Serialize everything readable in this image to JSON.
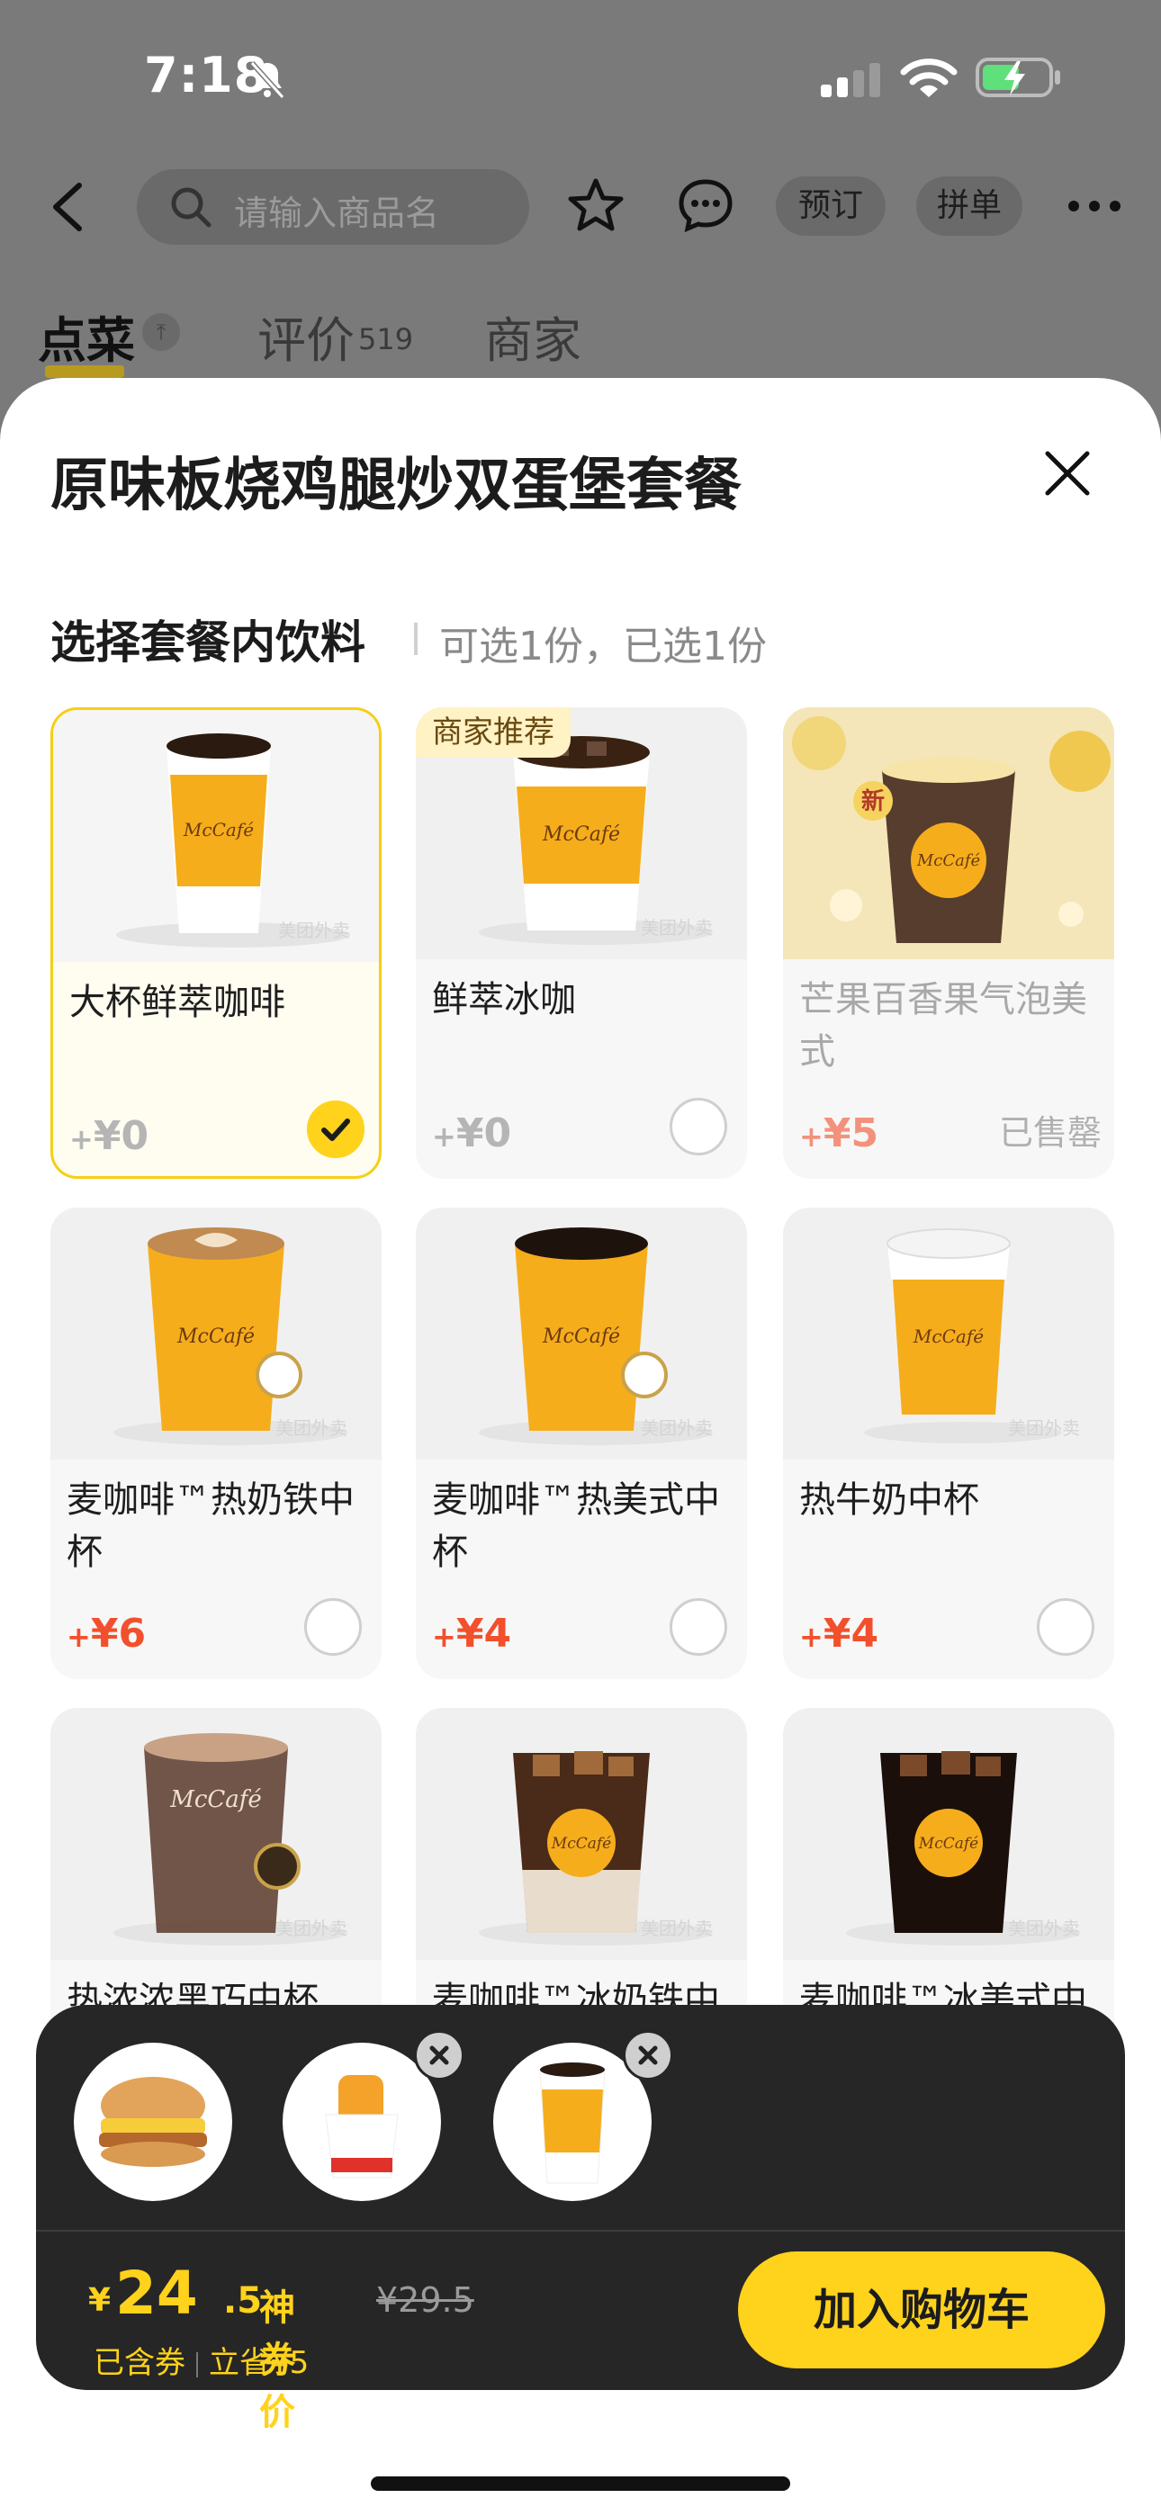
{
  "status": {
    "time": "7:18"
  },
  "nav": {
    "search_placeholder": "请输入商品名",
    "book_label": "预订",
    "group_label": "拼单"
  },
  "tabs": {
    "order": "点菜",
    "review": "评价",
    "review_count": "519",
    "shop": "商家"
  },
  "sheet": {
    "title": "原味板烧鸡腿炒双蛋堡套餐",
    "section_title": "选择套餐内饮料",
    "section_sub": "可选1份，已选1份"
  },
  "drinks": [
    {
      "name": "大杯鲜萃咖啡",
      "price": "0",
      "selected": true
    },
    {
      "name": "鲜萃冰咖",
      "price": "0",
      "badge": "商家推荐"
    },
    {
      "name": "芒果百香果气泡美式",
      "price": "5",
      "status": "已售罄",
      "tag": "新"
    },
    {
      "name": "麦咖啡™热奶铁中杯",
      "price": "6"
    },
    {
      "name": "麦咖啡™热美式中杯",
      "price": "4"
    },
    {
      "name": "热牛奶中杯",
      "price": "4"
    },
    {
      "name": "热浓浓黑巧中杯"
    },
    {
      "name": "麦咖啡™冰奶铁中"
    },
    {
      "name": "麦咖啡™冰美式中"
    }
  ],
  "price_prefix": "+",
  "yen": "¥",
  "card_watermark": "美团外卖",
  "cup_brand": "McCafé",
  "bottom": {
    "yen": "¥",
    "price_main": "24",
    "price_dec": ".5",
    "price_label": "神券价",
    "price_orig": "¥29.5",
    "coupon_included": "已含券",
    "coupon_saved": "立省¥5",
    "cart_button": "加入购物车"
  },
  "colors": {
    "accent": "#ffd21c",
    "price": "#f2502c",
    "dark_bar": "#262626"
  }
}
